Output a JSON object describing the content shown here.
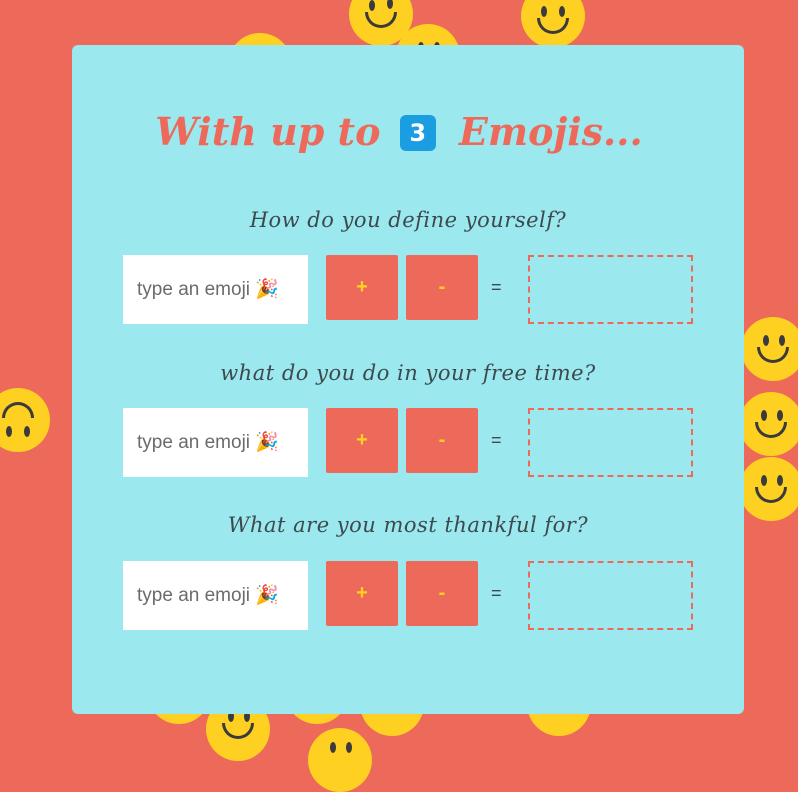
{
  "title": {
    "prefix": "With up to",
    "badge": "3",
    "suffix": "Emojis..."
  },
  "questions": [
    {
      "prompt": "How do you define yourself?",
      "placeholder": "type an emoji 🎉",
      "plus": "+",
      "minus": "-",
      "equals": "="
    },
    {
      "prompt": "what do you do in your free time?",
      "placeholder": "type an emoji 🎉",
      "plus": "+",
      "minus": "-",
      "equals": "="
    },
    {
      "prompt": "What are you most thankful for?",
      "placeholder": "type an emoji 🎉",
      "plus": "+",
      "minus": "-",
      "equals": "="
    }
  ],
  "colors": {
    "background": "#ed6a5a",
    "card": "#9be8ef",
    "accent": "#ed6a5a",
    "badge": "#1a9de1",
    "smiley": "#fdd022"
  }
}
